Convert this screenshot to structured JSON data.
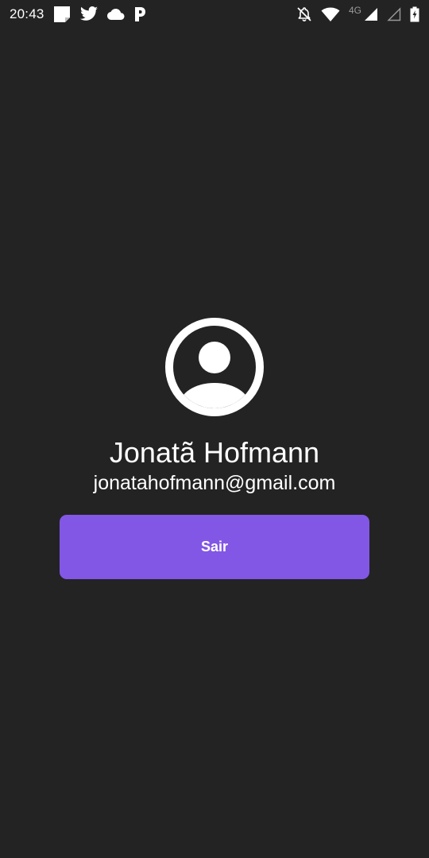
{
  "status_bar": {
    "time": "20:43",
    "network_label": "4G",
    "notification_icons": [
      "note-icon",
      "twitter-icon",
      "cloud-icon",
      "parking-p-icon"
    ],
    "system_icons": [
      "notifications-off-icon",
      "wifi-icon",
      "cell-signal-icon",
      "cell-signal-empty-icon",
      "battery-icon"
    ]
  },
  "profile": {
    "name": "Jonatã Hofmann",
    "email": "jonatahofmann@gmail.com",
    "avatar_icon": "account-circle-icon"
  },
  "actions": {
    "logout_label": "Sair"
  },
  "colors": {
    "background": "#232323",
    "accent": "#8257e5",
    "text": "#ffffff"
  }
}
